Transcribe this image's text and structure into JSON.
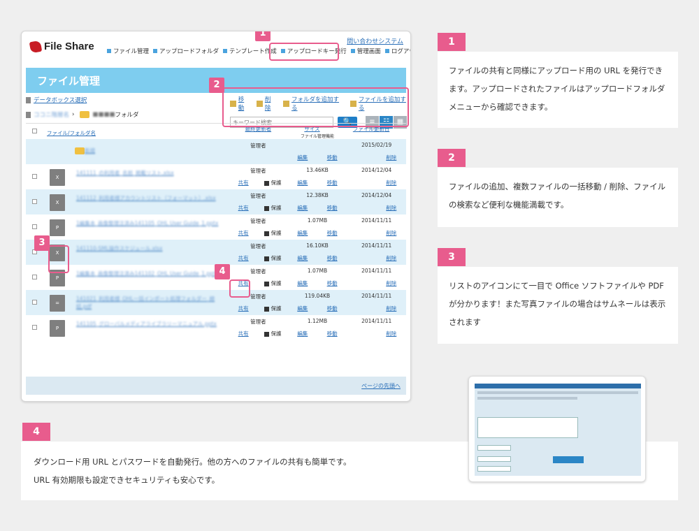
{
  "app": {
    "logo_text": "File Share",
    "contact_link": "問い合わせシステム",
    "nav": [
      "ファイル管理",
      "アップロードフォルダ",
      "テンプレート作成",
      "アップロードキー発行",
      "管理画面",
      "ログアウト"
    ],
    "page_title": "ファイル管理",
    "breadcrumb_top": "データボックス選択",
    "breadcrumb_path_blurred": "ココニ階層名",
    "breadcrumb_current": "フォルダ",
    "page_top_link": "ページの先頭へ"
  },
  "toolbar": {
    "move": "移動",
    "delete": "削除",
    "add_folder": "フォルダを追加する",
    "add_file": "ファイルを追加する",
    "search_placeholder": "キーワード検索",
    "search_btn": "🔍",
    "view_list": "≡",
    "view_detail": "☷",
    "view_grid": "▦"
  },
  "table": {
    "col_name": "ファイル/フォルダ名",
    "col_owner": "最終更新者",
    "col_size": "サイズ",
    "col_date": "ファイル更新日",
    "col_sub": "ファイル管理機能",
    "rows": [
      {
        "type": "folder",
        "icon": "",
        "name": "新規",
        "owner": "管理者",
        "size": "",
        "date": "2015/02/19",
        "share": "",
        "protect": "",
        "edit": "編集",
        "move": "移動",
        "del": "削除"
      },
      {
        "type": "file",
        "icon": "X",
        "name": "141111_の利用者_名前_掲載リスト.xlsx",
        "owner": "管理者",
        "size": "13.46KB",
        "date": "2014/12/04",
        "share": "共有",
        "protect": "保護",
        "edit": "編集",
        "move": "移動",
        "del": "削除"
      },
      {
        "type": "file",
        "icon": "X",
        "name": "141112_利用者様アカウントリスト（フォーマット）.xlsx",
        "owner": "管理者",
        "size": "12.38KB",
        "date": "2014/12/04",
        "share": "共有",
        "protect": "保護",
        "edit": "編集",
        "move": "移動",
        "del": "削除"
      },
      {
        "type": "file",
        "icon": "P",
        "name": "1編集本_画像整理注済み141105_OHL User Guide_1.pptx",
        "owner": "管理者",
        "size": "1.07MB",
        "date": "2014/11/11",
        "share": "共有",
        "protect": "保護",
        "edit": "編集",
        "move": "移動",
        "del": "削除"
      },
      {
        "type": "file",
        "icon": "X",
        "name": "141110-SML操作スケジュール.xlsx",
        "owner": "管理者",
        "size": "16.10KB",
        "date": "2014/11/11",
        "share": "共有",
        "protect": "保護",
        "edit": "編集",
        "move": "移動",
        "del": "削除"
      },
      {
        "type": "file",
        "icon": "P",
        "name": "1編集本_画像整理注済み141102_OHL User Guide_1.pptx",
        "owner": "管理者",
        "size": "1.07MB",
        "date": "2014/11/11",
        "share": "共有",
        "protect": "保護",
        "edit": "編集",
        "move": "移動",
        "del": "削除"
      },
      {
        "type": "file",
        "icon": "=",
        "name": "141021_利用者様_OHL一括インポート処理フォルダー_締結.pdf",
        "owner": "管理者",
        "size": "119.04KB",
        "date": "2014/11/11",
        "share": "共有",
        "protect": "保護",
        "edit": "編集",
        "move": "移動",
        "del": "削除"
      },
      {
        "type": "file",
        "icon": "P",
        "name": "141105_グローバルメディアライブラリーマニュアル.pptx",
        "owner": "管理者",
        "size": "1.12MB",
        "date": "2014/11/11",
        "share": "共有",
        "protect": "保護",
        "edit": "編集",
        "move": "移動",
        "del": "削除"
      }
    ]
  },
  "badges": [
    "1",
    "2",
    "3",
    "4"
  ],
  "notes": {
    "n1": "ファイルの共有と同様にアップロード用の URL を発行できます。アップロードされたファイルはアップロードフォルダメニューから確認できます。",
    "n2": "ファイルの追加、複数ファイルの一括移動 / 削除、ファイルの検索など便利な機能満載です。",
    "n3": "リストのアイコンにて一目で Office ソフトファイルや PDF が分かります！また写真ファイルの場合はサムネールは表示されます",
    "n4_line1": "ダウンロード用 URL とパスワードを自動発行。他の方へのファイルの共有も簡単です。",
    "n4_line2": "URL 有効期限も設定できセキュリティも安心です。"
  },
  "colors": {
    "accent_pink": "#e85c8d",
    "header_blue": "#7ecdef",
    "link_blue": "#2a6fb8",
    "alt_row": "#dff0f9"
  }
}
